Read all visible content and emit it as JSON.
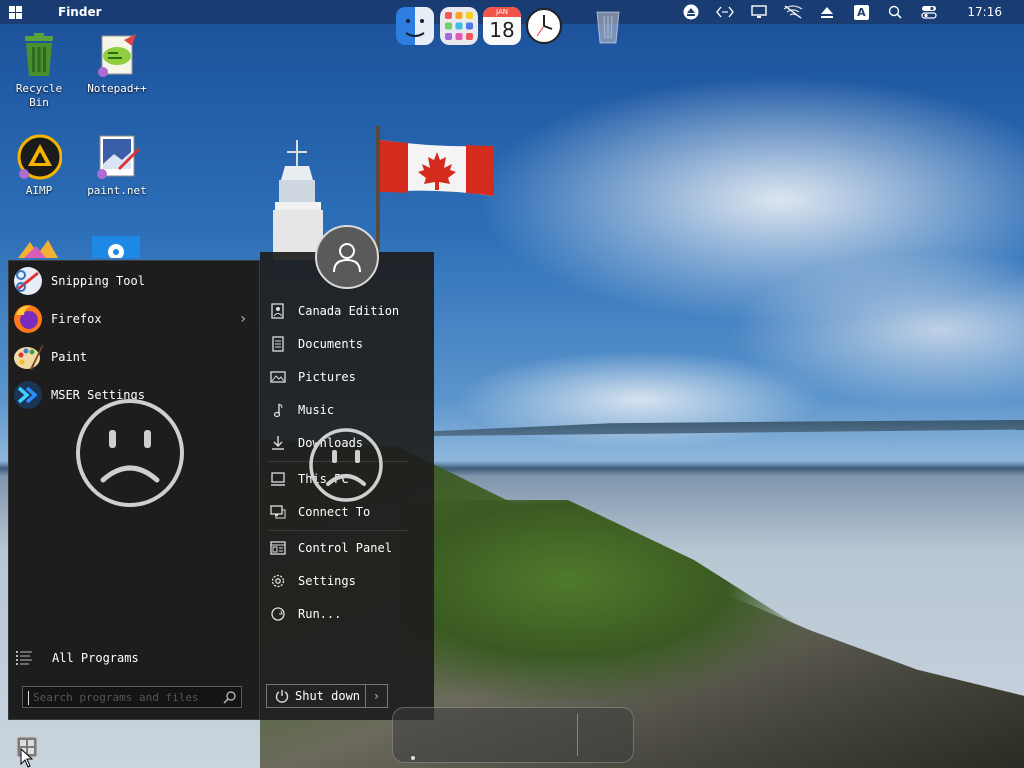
{
  "menubar": {
    "app_name": "Finder",
    "clock": "17:16",
    "status_icons": [
      "eject-icon",
      "code-icon",
      "monitor-icon",
      "network-off-icon",
      "upload-icon",
      "keyboard-layout-icon",
      "search-icon",
      "control-center-icon"
    ],
    "keyboard_layout": "A"
  },
  "desktop": {
    "icons": [
      {
        "label_line1": "Recycle",
        "label_line2": "Bin",
        "icon": "recycle-bin-icon"
      },
      {
        "label_line1": "Notepad++",
        "label_line2": "",
        "icon": "notepadpp-icon"
      },
      {
        "label_line1": "AIMP",
        "label_line2": "",
        "icon": "aimp-icon"
      },
      {
        "label_line1": "paint.net",
        "label_line2": "",
        "icon": "paintnet-icon"
      }
    ]
  },
  "start_menu": {
    "programs": [
      {
        "label": "Snipping Tool",
        "icon": "snipping-tool-icon",
        "has_submenu": false
      },
      {
        "label": "Firefox",
        "icon": "firefox-icon",
        "has_submenu": true
      },
      {
        "label": "Paint",
        "icon": "paint-icon",
        "has_submenu": false
      },
      {
        "label": "MSER Settings",
        "icon": "mser-settings-icon",
        "has_submenu": false
      }
    ],
    "submenu_arrow": "›",
    "all_programs": "All Programs",
    "search_placeholder": "Search programs and files",
    "places": [
      {
        "label": "Canada Edition",
        "icon": "user-folder-icon"
      },
      {
        "label": "Documents",
        "icon": "document-icon"
      },
      {
        "label": "Pictures",
        "icon": "picture-icon"
      },
      {
        "label": "Music",
        "icon": "music-icon"
      },
      {
        "label": "Downloads",
        "icon": "download-icon"
      },
      {
        "label": "This PC",
        "icon": "computer-icon"
      },
      {
        "label": "Connect To",
        "icon": "network-icon"
      },
      {
        "label": "Control Panel",
        "icon": "control-panel-icon"
      },
      {
        "label": "Settings",
        "icon": "gear-icon"
      },
      {
        "label": "Run...",
        "icon": "run-icon"
      }
    ],
    "shutdown_label": "Shut down",
    "shutdown_arrow": "›"
  },
  "dock": {
    "items": [
      "finder-icon",
      "launchpad-icon",
      "calendar-icon",
      "clock-icon",
      "trash-icon"
    ],
    "calendar_month": "JAN",
    "calendar_day": "18"
  },
  "colors": {
    "menu_bg": "#1d1d1d",
    "menu_text": "#ffffff",
    "sad_face": "#cfcfcf",
    "canada_red": "#d52b1e"
  }
}
